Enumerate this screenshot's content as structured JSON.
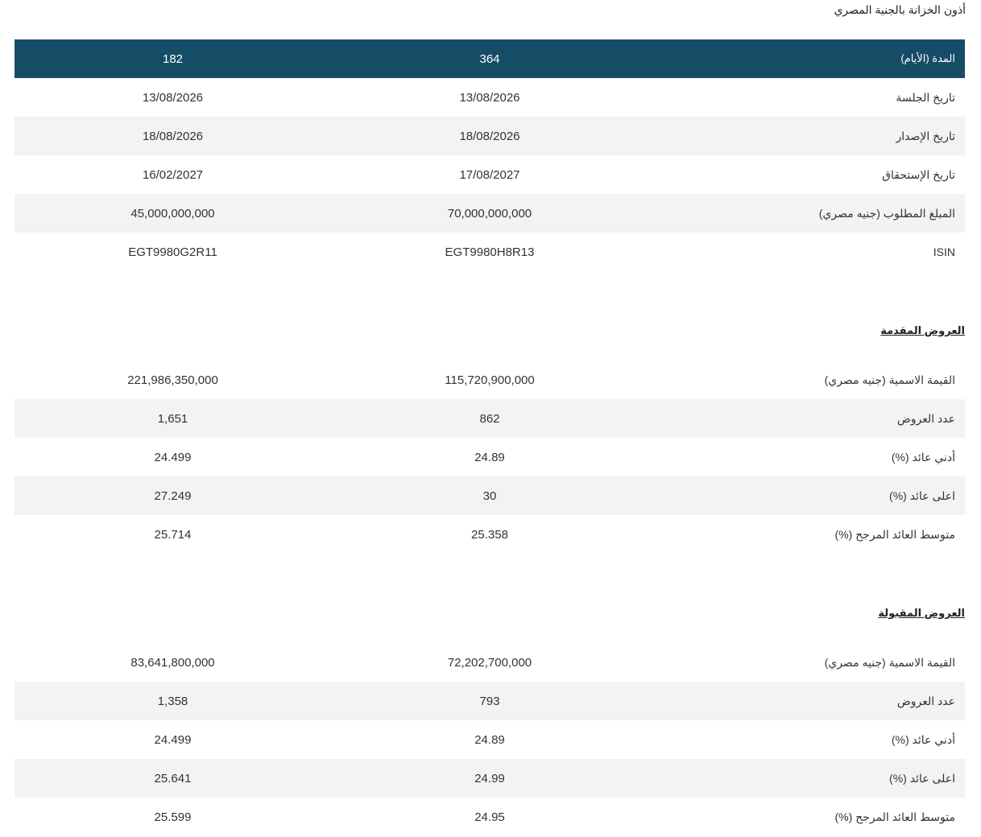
{
  "page_title": "أذون الخزانة بالجنية المصري",
  "terms": {
    "label": "المدة (الأيام)",
    "values": [
      "364",
      "182"
    ]
  },
  "details": [
    {
      "label": "تاريخ الجلسة",
      "values": [
        "13/08/2026",
        "13/08/2026"
      ]
    },
    {
      "label": "تاريخ الإصدار",
      "values": [
        "18/08/2026",
        "18/08/2026"
      ]
    },
    {
      "label": "تاريخ الإستحقاق",
      "values": [
        "17/08/2027",
        "16/02/2027"
      ]
    },
    {
      "label": "المبلغ المطلوب (جنيه مصري)",
      "values": [
        "70,000,000,000",
        "45,000,000,000"
      ]
    },
    {
      "label": "ISIN",
      "values": [
        "EGT9980H8R13",
        "EGT9980G2R11"
      ]
    }
  ],
  "offered": {
    "title": "العروض المقدمة",
    "rows": [
      {
        "label": "القيمة الاسمية (جنيه مصري)",
        "values": [
          "115,720,900,000",
          "221,986,350,000"
        ]
      },
      {
        "label": "عدد العروض",
        "values": [
          "862",
          "1,651"
        ]
      },
      {
        "label": "أدني عائد (%)",
        "values": [
          "24.89",
          "24.499"
        ]
      },
      {
        "label": "اعلى عائد (%)",
        "values": [
          "30",
          "27.249"
        ]
      },
      {
        "label": "متوسط العائد المرجح (%)",
        "values": [
          "25.358",
          "25.714"
        ]
      }
    ]
  },
  "accepted": {
    "title": "العروض المقبولة",
    "rows": [
      {
        "label": "القيمة الاسمية (جنيه مصري)",
        "values": [
          "72,202,700,000",
          "83,641,800,000"
        ]
      },
      {
        "label": "عدد العروض",
        "values": [
          "793",
          "1,358"
        ]
      },
      {
        "label": "أدني عائد (%)",
        "values": [
          "24.89",
          "24.499"
        ]
      },
      {
        "label": "اعلى عائد (%)",
        "values": [
          "24.99",
          "25.641"
        ]
      },
      {
        "label": "متوسط العائد المرجح (%)",
        "values": [
          "24.95",
          "25.599"
        ]
      }
    ]
  },
  "colors": {
    "header_bg": "#164d66",
    "stripe_bg": "#f2f3f5"
  }
}
